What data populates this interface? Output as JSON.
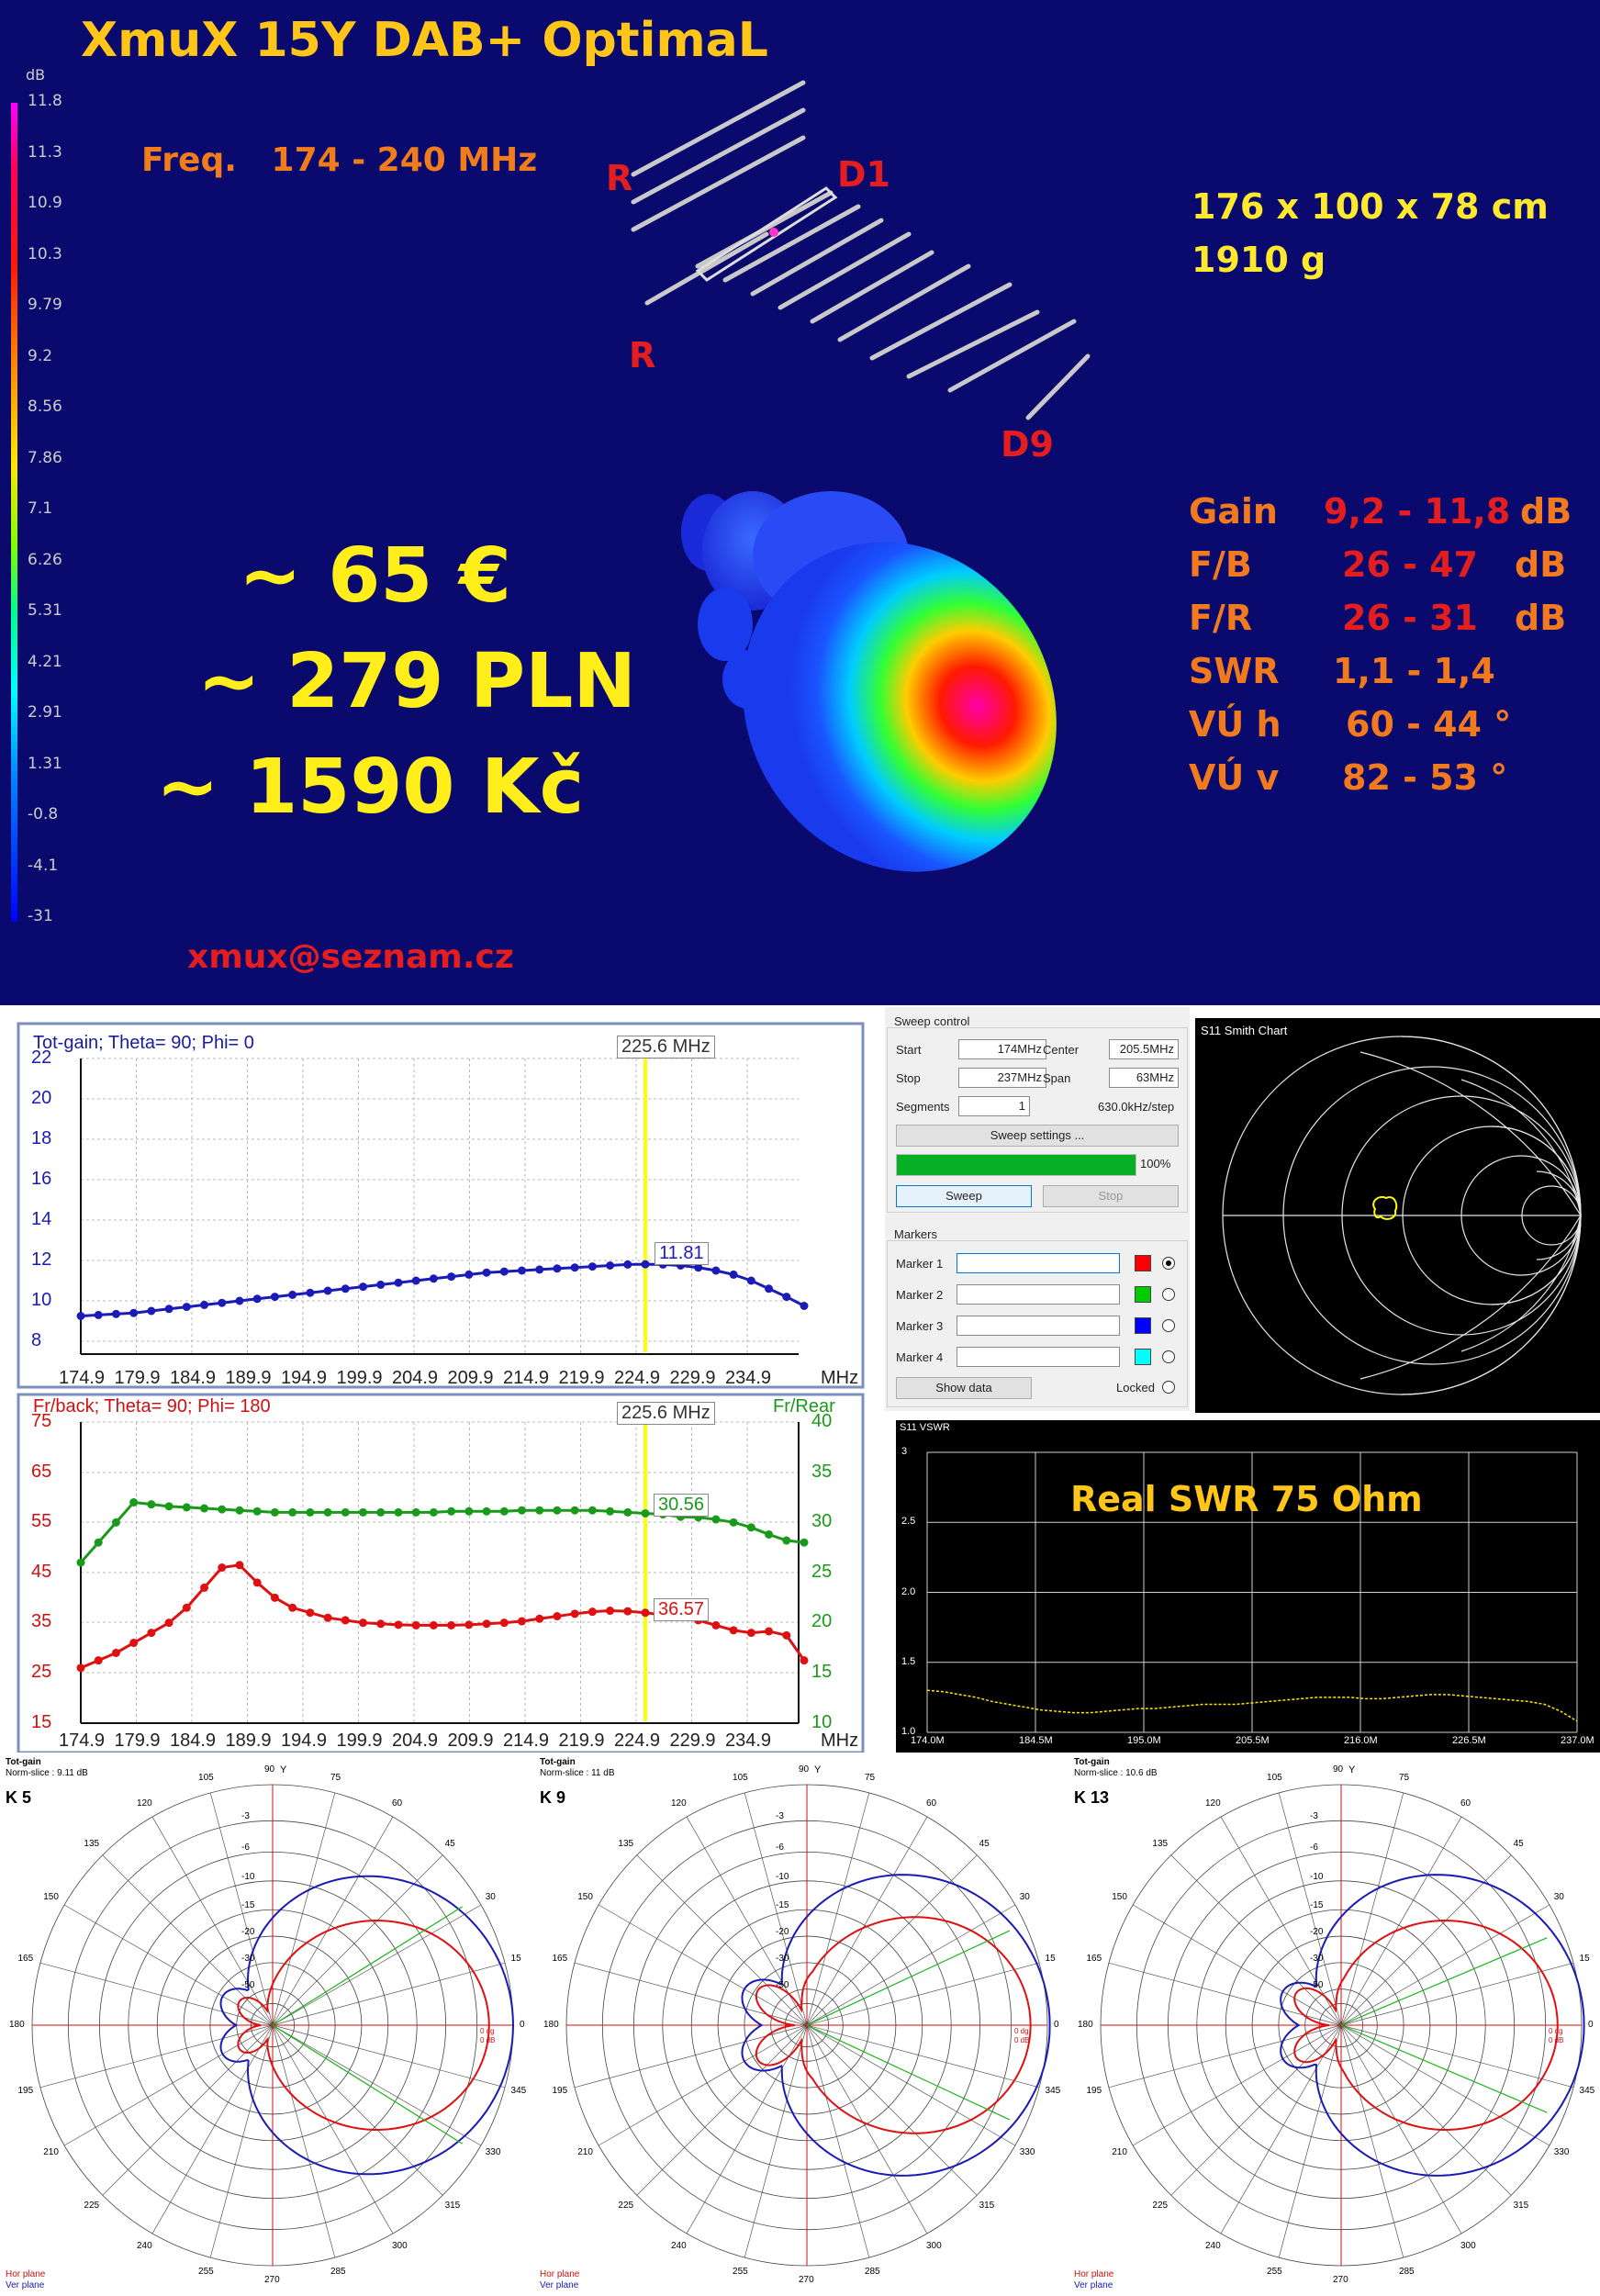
{
  "poster": {
    "title": "XmuX 15Y DAB+ OptimaL",
    "freq_label": "Freq.",
    "freq_range": "174 - 240 MHz",
    "dimensions": "176 x 100 x 78  cm",
    "weight": "1910  g",
    "prices": [
      "~ 65 €",
      "~ 279 PLN",
      "~ 1590 Kč"
    ],
    "email": "xmux@seznam.cz",
    "element_labels": {
      "reflector": "R",
      "director_first": "D1",
      "director_last": "D9"
    },
    "specs": [
      {
        "label": "Gain",
        "value": "9,2 - 11,8",
        "unit": "dB"
      },
      {
        "label": "F/B",
        "value": "26 - 47",
        "unit": "dB"
      },
      {
        "label": "F/R",
        "value": "26 - 31",
        "unit": "dB"
      },
      {
        "label": "SWR",
        "value": "1,1 - 1,4",
        "unit": ""
      },
      {
        "label": "VÚ h",
        "value": "60 - 44 °",
        "unit": ""
      },
      {
        "label": "VÚ v",
        "value": "82 - 53 °",
        "unit": ""
      }
    ],
    "scale": {
      "unit": "dB",
      "ticks": [
        "11.8",
        "11.3",
        "10.9",
        "10.3",
        "9.79",
        "9.2",
        "8.56",
        "7.86",
        "7.1",
        "6.26",
        "5.31",
        "4.21",
        "2.91",
        "1.31",
        "-0.8",
        "-4.1",
        "-31"
      ]
    },
    "colors": {
      "background": "#0a0a6e",
      "title": "#ffc619",
      "accent_orange": "#f27a1e",
      "accent_red": "#e41e1e",
      "price_yellow": "#ffee1a"
    }
  },
  "gain_chart": {
    "title": "Tot-gain; Theta= 90; Phi= 0",
    "marker_freq": "225.6 MHz",
    "marker_value": "11.81",
    "unit": "MHz",
    "y_ticks": [
      "22",
      "20",
      "18",
      "16",
      "14",
      "12",
      "10",
      "8"
    ],
    "x_ticks": [
      "174.9",
      "179.9",
      "184.9",
      "189.9",
      "194.9",
      "199.9",
      "204.9",
      "209.9",
      "214.9",
      "219.9",
      "224.9",
      "229.9",
      "234.9"
    ]
  },
  "fb_chart": {
    "title_left": "Fr/back; Theta= 90; Phi= 180",
    "title_right": "Fr/Rear",
    "marker_freq": "225.6 MHz",
    "marker_value_green": "30.56",
    "marker_value_red": "36.57",
    "unit": "MHz",
    "y_left_ticks": [
      "75",
      "65",
      "55",
      "45",
      "35",
      "25",
      "15"
    ],
    "y_right_ticks": [
      "40",
      "35",
      "30",
      "25",
      "20",
      "15",
      "10"
    ],
    "x_ticks": [
      "174.9",
      "179.9",
      "184.9",
      "189.9",
      "194.9",
      "199.9",
      "204.9",
      "209.9",
      "214.9",
      "219.9",
      "224.9",
      "229.9",
      "234.9"
    ]
  },
  "sweep_control": {
    "title": "Sweep control",
    "start_label": "Start",
    "start_value": "174MHz",
    "center_label": "Center",
    "center_value": "205.5MHz",
    "stop_label": "Stop",
    "stop_value": "237MHz",
    "span_label": "Span",
    "span_value": "63MHz",
    "segments_label": "Segments",
    "segments_value": "1",
    "step_text": "630.0kHz/step",
    "settings_button": "Sweep settings ...",
    "progress_text": "100%",
    "progress": 1.0,
    "sweep_button": "Sweep",
    "stop_button": "Stop",
    "markers_title": "Markers",
    "markers": [
      {
        "label": "Marker 1",
        "color": "#ff0000",
        "selected": true
      },
      {
        "label": "Marker 2",
        "color": "#00cc00",
        "selected": false
      },
      {
        "label": "Marker 3",
        "color": "#0000ff",
        "selected": false
      },
      {
        "label": "Marker 4",
        "color": "#00ffff",
        "selected": false
      }
    ],
    "show_data_button": "Show data",
    "locked_label": "Locked"
  },
  "smith_chart": {
    "title": "S11 Smith Chart"
  },
  "vswr_chart": {
    "title": "S11 VSWR",
    "annotation": "Real SWR 75 Ohm",
    "y_ticks": [
      "3",
      "2.5",
      "2.0",
      "1.5",
      "1.0"
    ],
    "x_ticks": [
      "174.0M",
      "184.5M",
      "195.0M",
      "205.5M",
      "216.0M",
      "226.5M",
      "237.0M"
    ]
  },
  "polar_plots": [
    {
      "name": "K 5",
      "header": "Tot-gain",
      "subheader": "Norm-slice : 9.11 dB"
    },
    {
      "name": "K 9",
      "header": "Tot-gain",
      "subheader": "Norm-slice : 11 dB"
    },
    {
      "name": "K 13",
      "header": "Tot-gain",
      "subheader": "Norm-slice : 10.6 dB"
    }
  ],
  "polar_common": {
    "angles": [
      "90",
      "75",
      "60",
      "45",
      "30",
      "15",
      "0",
      "345",
      "330",
      "315",
      "300",
      "285",
      "270",
      "255",
      "240",
      "225",
      "210",
      "195",
      "180",
      "165",
      "150",
      "135",
      "120",
      "105"
    ],
    "radial": [
      "-3",
      "-6",
      "-10",
      "-15",
      "-20",
      "-30",
      "-50"
    ],
    "y_label": "Y",
    "legend": [
      "Hor plane",
      "Ver plane"
    ],
    "note_lines": [
      "0 dg",
      "0 dB"
    ]
  }
}
